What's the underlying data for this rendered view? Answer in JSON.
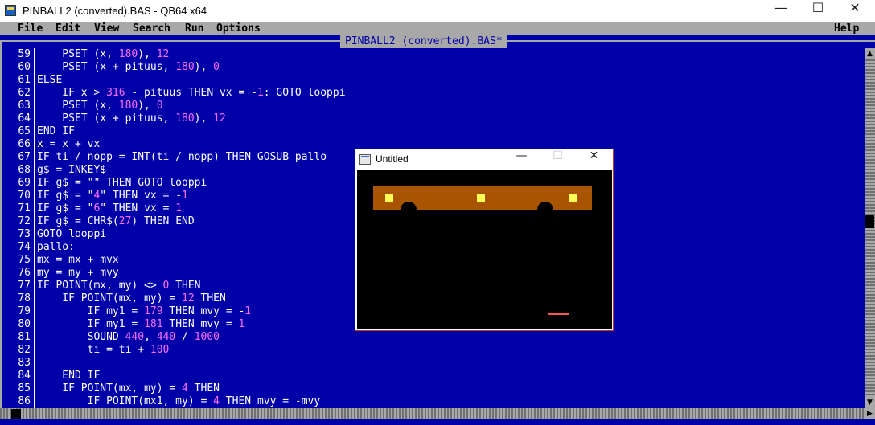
{
  "window": {
    "title": "PINBALL2 (converted).BAS - QB64 x64",
    "minimize": "—",
    "maximize": "☐",
    "close": "✕"
  },
  "menu": {
    "items": [
      "File",
      "Edit",
      "View",
      "Search",
      "Run",
      "Options"
    ],
    "help": "Help"
  },
  "editor": {
    "document_title": "PINBALL2 (converted).BAS*",
    "lines": [
      {
        "n": "59",
        "text": "    PSET (x, 180), 12"
      },
      {
        "n": "60",
        "text": "    PSET (x + pituus, 180), 0"
      },
      {
        "n": "61",
        "text": "ELSE"
      },
      {
        "n": "62",
        "text": "    IF x > 316 - pituus THEN vx = -1: GOTO looppi"
      },
      {
        "n": "63",
        "text": "    PSET (x, 180), 0"
      },
      {
        "n": "64",
        "text": "    PSET (x + pituus, 180), 12"
      },
      {
        "n": "65",
        "text": "END IF"
      },
      {
        "n": "66",
        "text": "x = x + vx"
      },
      {
        "n": "67",
        "text": "IF ti / nopp = INT(ti / nopp) THEN GOSUB pallo"
      },
      {
        "n": "68",
        "text": "g$ = INKEY$"
      },
      {
        "n": "69",
        "text": "IF g$ = \"\" THEN GOTO looppi"
      },
      {
        "n": "70",
        "text": "IF g$ = \"4\" THEN vx = -1"
      },
      {
        "n": "71",
        "text": "IF g$ = \"6\" THEN vx = 1"
      },
      {
        "n": "72",
        "text": "IF g$ = CHR$(27) THEN END"
      },
      {
        "n": "73",
        "text": "GOTO looppi"
      },
      {
        "n": "74",
        "text": "pallo:"
      },
      {
        "n": "75",
        "text": "mx = mx + mvx"
      },
      {
        "n": "76",
        "text": "my = my + mvy"
      },
      {
        "n": "77",
        "text": "IF POINT(mx, my) <> 0 THEN"
      },
      {
        "n": "78",
        "text": "    IF POINT(mx, my) = 12 THEN"
      },
      {
        "n": "79",
        "text": "        IF my1 = 179 THEN mvy = -1"
      },
      {
        "n": "80",
        "text": "        IF my1 = 181 THEN mvy = 1"
      },
      {
        "n": "81",
        "text": "        SOUND 440, 440 / 1000"
      },
      {
        "n": "82",
        "text": "        ti = ti + 100"
      },
      {
        "n": "83",
        "text": ""
      },
      {
        "n": "84",
        "text": "    END IF"
      },
      {
        "n": "85",
        "text": "    IF POINT(mx, my) = 4 THEN"
      },
      {
        "n": "86",
        "text": "        IF POINT(mx1, my) = 4 THEN mvy = -mvy"
      }
    ]
  },
  "output_window": {
    "title": "Untitled",
    "minimize": "—",
    "maximize": "☐",
    "close": "✕"
  },
  "colors": {
    "editor_bg": "#0000a8",
    "number_literal": "#ff6cff",
    "text": "#ffffff",
    "bar_brown": "#a85400",
    "yellow": "#ffff54",
    "paddle_red": "#fc5454"
  }
}
